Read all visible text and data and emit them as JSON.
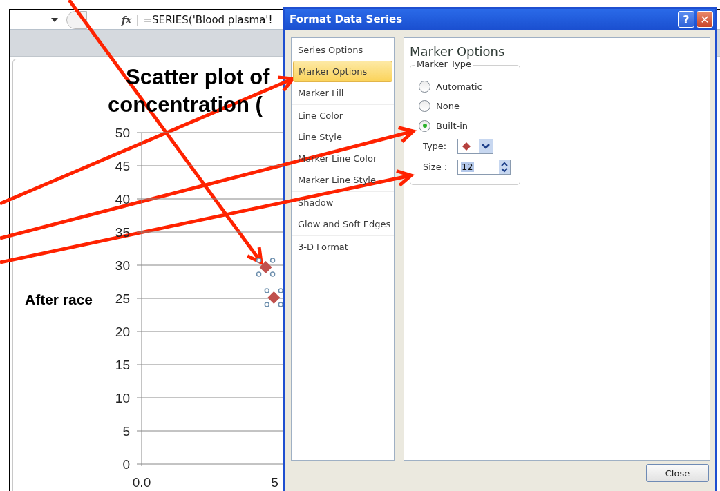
{
  "formula_bar": {
    "fx_label": "fx",
    "formula": "=SERIES('Blood plasma'!"
  },
  "chart": {
    "title_lines": [
      "Scatter plot of",
      "concentration ("
    ],
    "chart_data": {
      "type": "scatter",
      "ylabel": "After race",
      "x": [
        4.6,
        4.9
      ],
      "series": [
        {
          "color": "#c0504d",
          "values": [
            29.7,
            25.1
          ]
        }
      ],
      "yticks": [
        0,
        5,
        10,
        15,
        20,
        25,
        30,
        35,
        40,
        45,
        50
      ],
      "xticks": [
        {
          "value": 0,
          "label": "0.0"
        },
        {
          "value": 5,
          "label": "5"
        }
      ],
      "ylim": [
        0,
        50
      ],
      "xlim": [
        0,
        5.2
      ],
      "grid": true
    }
  },
  "dialog": {
    "title": "Format Data Series",
    "help": "?",
    "close_glyph": "✕",
    "sidebar": {
      "groups": [
        [
          {
            "label": "Series Options",
            "selected": false
          },
          {
            "label": "Marker Options",
            "selected": true
          },
          {
            "label": "Marker Fill",
            "selected": false
          }
        ],
        [
          {
            "label": "Line Color",
            "selected": false
          },
          {
            "label": "Line Style",
            "selected": false
          },
          {
            "label": "Marker Line Color",
            "selected": false
          },
          {
            "label": "Marker Line Style",
            "selected": false
          }
        ],
        [
          {
            "label": "Shadow",
            "selected": false
          },
          {
            "label": "Glow and Soft Edges",
            "selected": false
          }
        ],
        [
          {
            "label": "3-D Format",
            "selected": false
          }
        ]
      ]
    },
    "panel": {
      "heading": "Marker Options",
      "group_label": "Marker Type",
      "radios": [
        {
          "label": "Automatic",
          "selected": false
        },
        {
          "label": "None",
          "selected": false
        },
        {
          "label": "Built-in",
          "selected": true
        }
      ],
      "type_label": "Type:",
      "size_label": "Size :",
      "size_value": "12"
    },
    "close_button": "Close"
  }
}
